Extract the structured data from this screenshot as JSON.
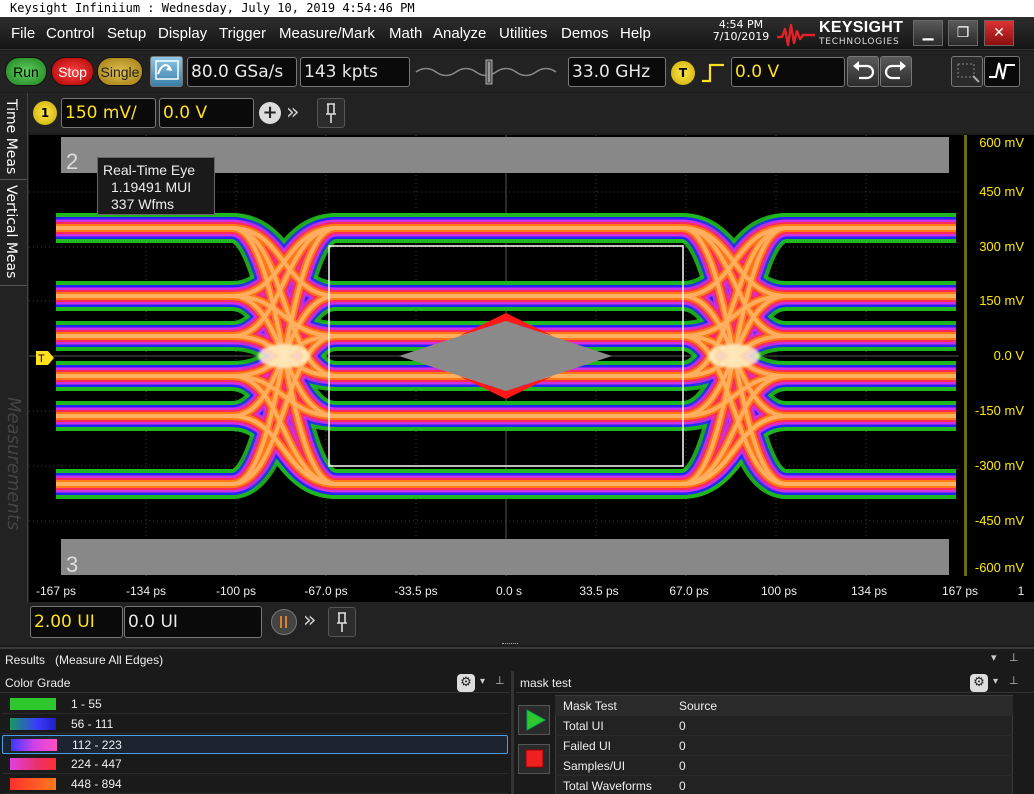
{
  "window": {
    "title": "Keysight Infiniium : Wednesday, July 10, 2019 4:54:46 PM",
    "clock_time": "4:54 PM",
    "clock_date": "7/10/2019",
    "brand_name": "KEYSIGHT",
    "brand_sub": "TECHNOLOGIES",
    "minimize_glyph": "▁",
    "maximize_glyph": "❐",
    "close_glyph": "✕"
  },
  "menu": [
    "File",
    "Control",
    "Setup",
    "Display",
    "Trigger",
    "Measure/Mark",
    "Math",
    "Analyze",
    "Utilities",
    "Demos",
    "Help"
  ],
  "toolbar": {
    "run_label": "Run",
    "stop_label": "Stop",
    "single_label": "Single",
    "sample_rate": "80.0 GSa/s",
    "memory_depth": "143 kpts",
    "bandwidth": "33.0 GHz",
    "trigger_badge": "T",
    "trigger_level": "0.0 V"
  },
  "channel": {
    "number": "1",
    "scale": "150 mV/",
    "offset": "0.0 V"
  },
  "side_tabs": {
    "time_meas": "Time Meas",
    "vertical_meas": "Vertical Meas",
    "measurements": "Measurements"
  },
  "plot": {
    "trace_label_2": "2",
    "trace_label_3": "3",
    "eye_info": {
      "title": "Real-Time Eye",
      "mui": "1.19491 MUI",
      "wfms": "337 Wfms"
    },
    "y_ticks": [
      "600 mV",
      "450 mV",
      "300 mV",
      "150 mV",
      "0.0 V",
      "-150 mV",
      "-300 mV",
      "-450 mV",
      "-600 mV"
    ],
    "x_ticks": [
      "-167 ps",
      "-134 ps",
      "-100 ps",
      "-67.0 ps",
      "-33.5 ps",
      "0.0 s",
      "33.5 ps",
      "67.0 ps",
      "100 ps",
      "134 ps",
      "167 ps"
    ],
    "x_extra": "1",
    "colors": {
      "accent_yellow": "#ffe020",
      "mask_gray": "#808080",
      "mask_red": "#ff1010"
    }
  },
  "horizontal": {
    "scale": "2.00 UI",
    "position": "0.0 UI"
  },
  "results": {
    "header": "Results",
    "header_sub": "(Measure All Edges)",
    "color_grade_title": "Color Grade",
    "color_grade": [
      {
        "range": "1 - 55",
        "color": "#2ec82e"
      },
      {
        "range": "56 - 111",
        "color": "#3a3aff"
      },
      {
        "range": "112 - 223",
        "color": "#d040e8"
      },
      {
        "range": "224 - 447",
        "color": "#e8306a"
      },
      {
        "range": "448 - 894",
        "color": "#ff7a1a"
      }
    ],
    "mask_panel_title": "mask test",
    "mask_table": {
      "headers": [
        "Mask Test",
        "Source"
      ],
      "rows": [
        {
          "name": "Total UI",
          "value": "0"
        },
        {
          "name": "Failed UI",
          "value": "0"
        },
        {
          "name": "Samples/UI",
          "value": "0"
        },
        {
          "name": "Total Waveforms",
          "value": "0"
        }
      ]
    }
  }
}
